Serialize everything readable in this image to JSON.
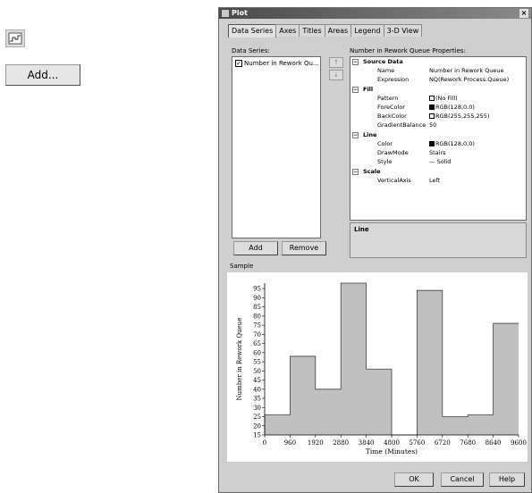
{
  "toolbar": {
    "icon": "plot-tool-icon",
    "add_label": "Add..."
  },
  "dialog": {
    "title": "Plot",
    "close_glyph": "×",
    "tabs": [
      "Data Series",
      "Axes",
      "Titles",
      "Areas",
      "Legend",
      "3-D View"
    ],
    "series_label": "Data Series:",
    "series_item": "Number in Rework Qu...",
    "series_checked": true,
    "up_arrow": "↑",
    "down_arrow": "↓",
    "add_btn": "Add",
    "remove_btn": "Remove",
    "props_label": "Number in Rework Queue Properties:",
    "props": {
      "source_data": "Source Data",
      "name_label": "Name",
      "name_value": "Number in Rework Queue",
      "expr_label": "Expression",
      "expr_value": "NQ(Rework Process.Queue)",
      "fill": "Fill",
      "pattern_label": "Pattern",
      "pattern_value": "(No Fill)",
      "fore_label": "ForeColor",
      "fore_value": "RGB(128,0,0)",
      "back_label": "BackColor",
      "back_value": "RGB(255,255,255)",
      "grad_label": "GradientBalance",
      "grad_value": "50",
      "line": "Line",
      "color_label": "Color",
      "color_value": "RGB(128,0,0)",
      "draw_label": "DrawMode",
      "draw_value": "Stairs",
      "style_label": "Style",
      "style_value": "— Solid",
      "scale": "Scale",
      "vaxis_label": "VerticalAxis",
      "vaxis_value": "Left"
    },
    "desc_title": "Line",
    "sample_label": "Sample",
    "ok_btn": "OK",
    "cancel_btn": "Cancel",
    "help_btn": "Help"
  },
  "chart_data": {
    "type": "line",
    "step": true,
    "xlabel": "Time (Minutes)",
    "ylabel": "Number in Rework Queue",
    "xlim": [
      0,
      9600
    ],
    "ylim": [
      15,
      98
    ],
    "x_ticks": [
      0,
      960,
      1920,
      2880,
      3840,
      4800,
      5760,
      6720,
      7680,
      8640,
      9600
    ],
    "y_ticks": [
      15,
      20,
      25,
      30,
      35,
      40,
      45,
      50,
      55,
      60,
      65,
      70,
      75,
      80,
      85,
      90,
      95
    ],
    "x": [
      0,
      960,
      1920,
      2880,
      3840,
      4800,
      5760,
      6720,
      7680,
      8640,
      9600
    ],
    "y": [
      26,
      58,
      40,
      98,
      51,
      10,
      94,
      25,
      26,
      76,
      76
    ],
    "line_color": "#404040",
    "fill_color": "#c0c0c0"
  }
}
